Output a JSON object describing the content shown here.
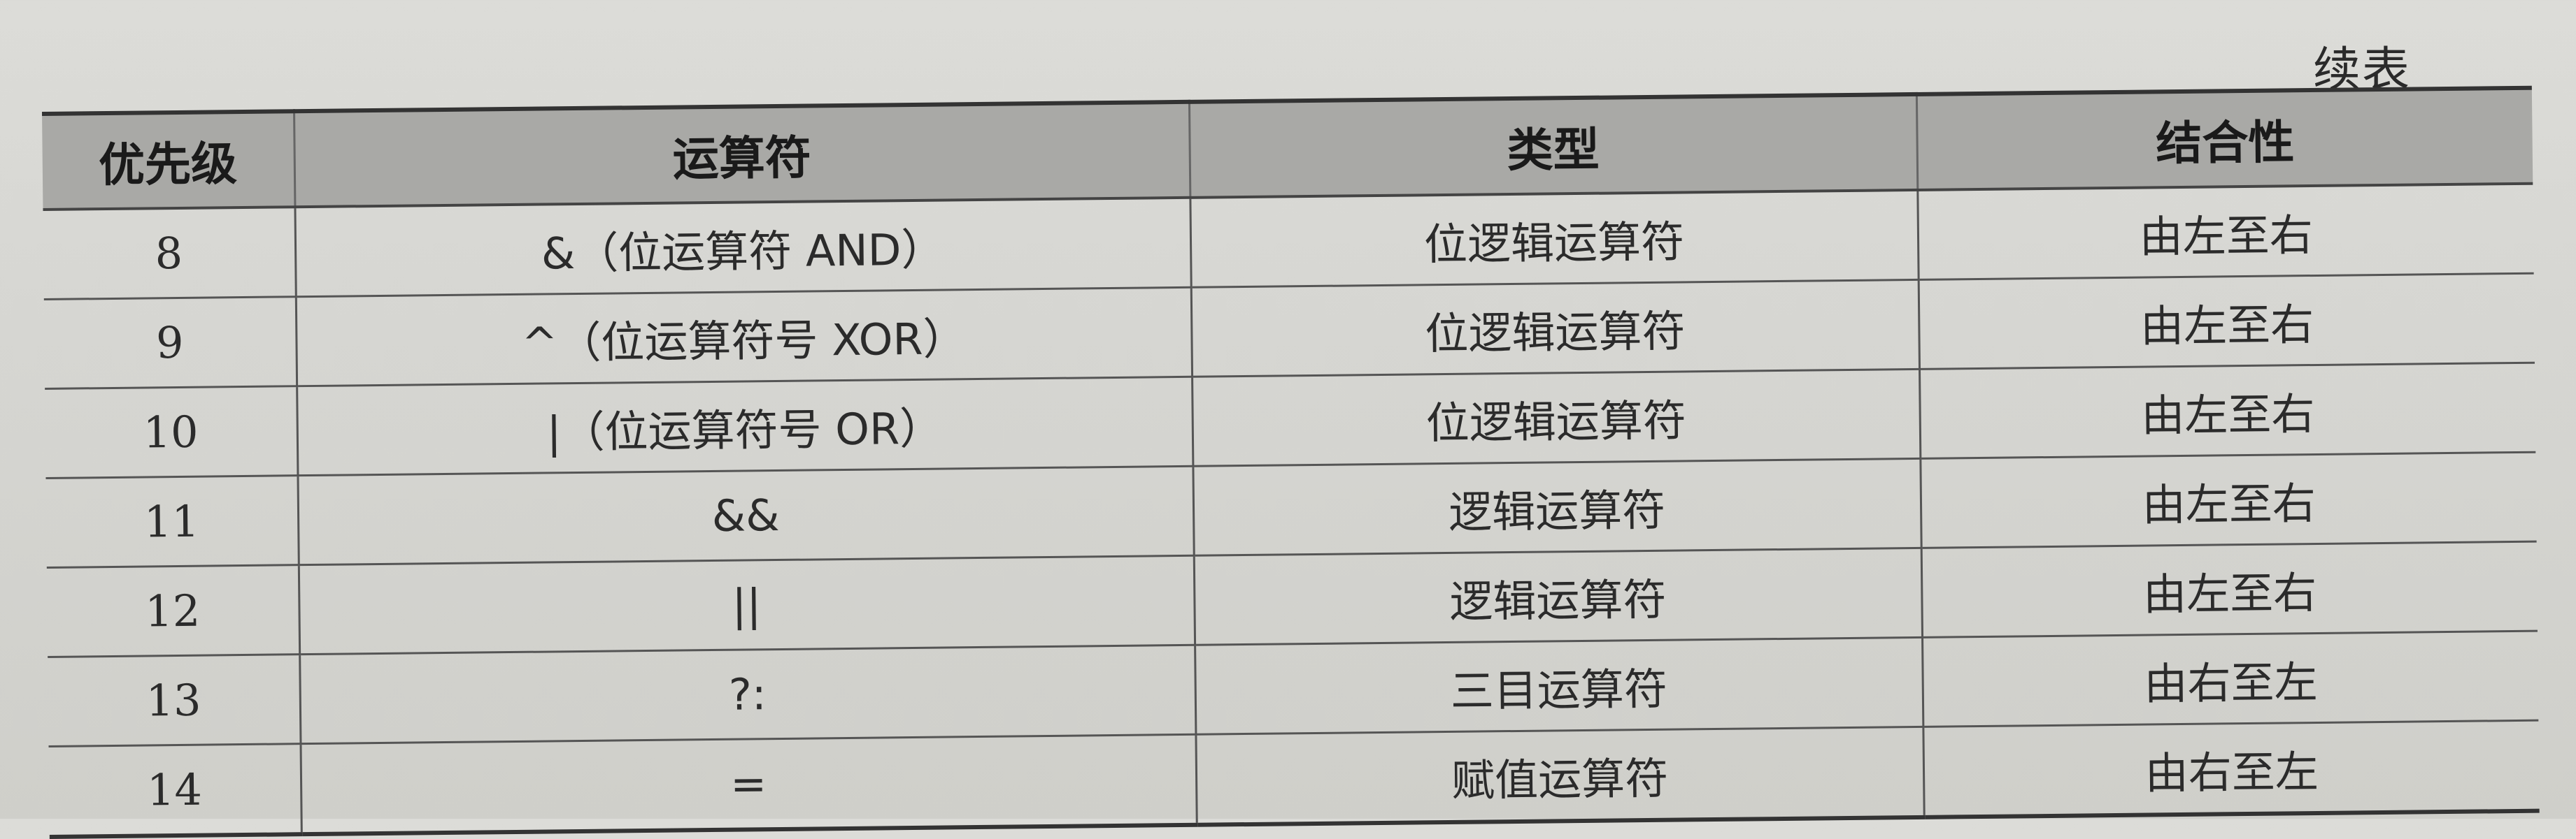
{
  "caption": "续表",
  "table": {
    "headers": [
      "优先级",
      "运算符",
      "类型",
      "结合性"
    ],
    "rows": [
      [
        "8",
        "&（位运算符 AND）",
        "位逻辑运算符",
        "由左至右"
      ],
      [
        "9",
        "^（位运算符号 XOR）",
        "位逻辑运算符",
        "由左至右"
      ],
      [
        "10",
        "|（位运算符号 OR）",
        "位逻辑运算符",
        "由左至右"
      ],
      [
        "11",
        "&&",
        "逻辑运算符",
        "由左至右"
      ],
      [
        "12",
        "||",
        "逻辑运算符",
        "由左至右"
      ],
      [
        "13",
        "?:",
        "三目运算符",
        "由右至左"
      ],
      [
        "14",
        "=",
        "赋值运算符",
        "由右至左"
      ]
    ]
  }
}
